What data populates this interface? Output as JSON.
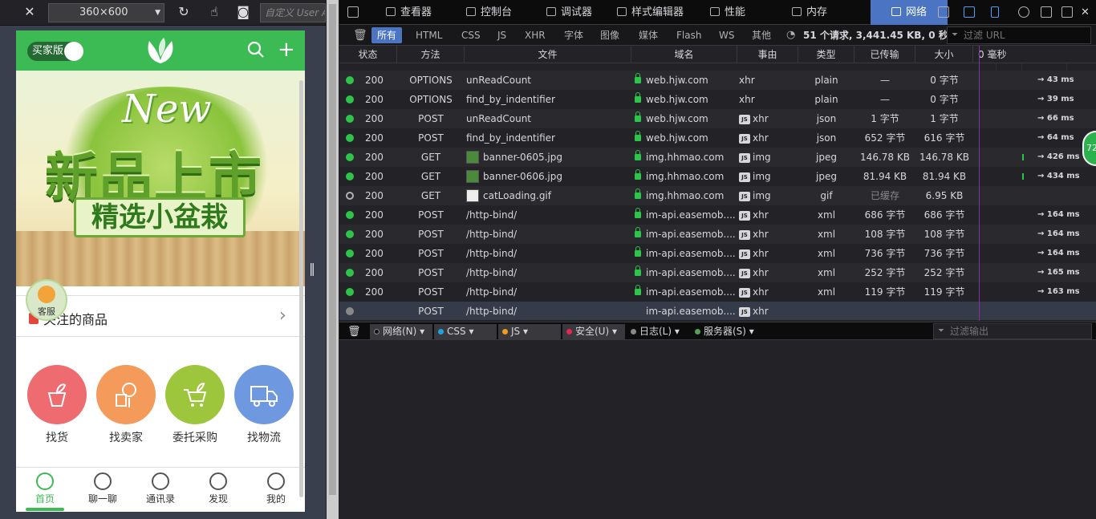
{
  "rdm": {
    "size_label": "360×600",
    "ua_placeholder": "自定义 User Agent"
  },
  "app": {
    "mode_label": "买家版",
    "banner": {
      "headline_en": "New",
      "headline": "新品上市",
      "subline": "精选小盆栽"
    },
    "kefu_label": "客服",
    "fav_label": "关注的商品",
    "categories": [
      {
        "label": "找货",
        "color": "#ee6b6f"
      },
      {
        "label": "找卖家",
        "color": "#f49a5a"
      },
      {
        "label": "委托采购",
        "color": "#9dc63d"
      },
      {
        "label": "找物流",
        "color": "#6e99e0"
      }
    ],
    "tabs": [
      "首页",
      "聊一聊",
      "通讯录",
      "发现",
      "我的"
    ]
  },
  "devtools": {
    "tabs": [
      "查看器",
      "控制台",
      "调试器",
      "样式编辑器",
      "性能",
      "内存",
      "网络"
    ],
    "filters": [
      "所有",
      "HTML",
      "CSS",
      "JS",
      "XHR",
      "字体",
      "图像",
      "媒体",
      "Flash",
      "WS",
      "其他"
    ],
    "summary": "51 个请求, 3,441.45 KB, 0 秒",
    "filter_placeholder": "过滤 URL",
    "columns": [
      "状态",
      "方法",
      "文件",
      "域名",
      "事由",
      "类型",
      "已传输",
      "大小",
      "0 毫秒"
    ],
    "requests": [
      {
        "status": "200",
        "method": "OPTIONS",
        "file": "unReadCount",
        "domain": "web.hjw.com",
        "cause": "xhr",
        "cause_js": false,
        "type": "plain",
        "transferred": "—",
        "size": "0 字节",
        "time": "→ 43 ms"
      },
      {
        "status": "200",
        "method": "OPTIONS",
        "file": "find_by_indentifier",
        "domain": "web.hjw.com",
        "cause": "xhr",
        "cause_js": false,
        "type": "plain",
        "transferred": "—",
        "size": "0 字节",
        "time": "→ 39 ms"
      },
      {
        "status": "200",
        "method": "POST",
        "file": "unReadCount",
        "domain": "web.hjw.com",
        "cause": "xhr",
        "cause_js": true,
        "type": "json",
        "transferred": "1 字节",
        "size": "1 字节",
        "time": "→ 66 ms"
      },
      {
        "status": "200",
        "method": "POST",
        "file": "find_by_indentifier",
        "domain": "web.hjw.com",
        "cause": "xhr",
        "cause_js": true,
        "type": "json",
        "transferred": "652 字节",
        "size": "616 字节",
        "time": "→ 64 ms"
      },
      {
        "status": "200",
        "method": "GET",
        "file": "banner-0605.jpg",
        "domain": "img.hhmao.com",
        "cause": "img",
        "cause_js": true,
        "type": "jpeg",
        "transferred": "146.78 KB",
        "size": "146.78 KB",
        "time": "→ 426 ms"
      },
      {
        "status": "200",
        "method": "GET",
        "file": "banner-0606.jpg",
        "domain": "img.hhmao.com",
        "cause": "img",
        "cause_js": true,
        "type": "jpeg",
        "transferred": "81.94 KB",
        "size": "81.94 KB",
        "time": "→ 434 ms"
      },
      {
        "status": "200",
        "method": "GET",
        "file": "catLoading.gif",
        "domain": "img.hhmao.com",
        "cause": "img",
        "cause_js": true,
        "type": "gif",
        "transferred": "已缓存",
        "size": "6.95 KB",
        "time": ""
      },
      {
        "status": "200",
        "method": "POST",
        "file": "/http-bind/",
        "domain": "im-api.easemob....",
        "cause": "xhr",
        "cause_js": true,
        "type": "xml",
        "transferred": "686 字节",
        "size": "686 字节",
        "time": "→ 164 ms"
      },
      {
        "status": "200",
        "method": "POST",
        "file": "/http-bind/",
        "domain": "im-api.easemob....",
        "cause": "xhr",
        "cause_js": true,
        "type": "xml",
        "transferred": "108 字节",
        "size": "108 字节",
        "time": "→ 164 ms"
      },
      {
        "status": "200",
        "method": "POST",
        "file": "/http-bind/",
        "domain": "im-api.easemob....",
        "cause": "xhr",
        "cause_js": true,
        "type": "xml",
        "transferred": "736 字节",
        "size": "736 字节",
        "time": "→ 164 ms"
      },
      {
        "status": "200",
        "method": "POST",
        "file": "/http-bind/",
        "domain": "im-api.easemob....",
        "cause": "xhr",
        "cause_js": true,
        "type": "xml",
        "transferred": "252 字节",
        "size": "252 字节",
        "time": "→ 165 ms"
      },
      {
        "status": "200",
        "method": "POST",
        "file": "/http-bind/",
        "domain": "im-api.easemob....",
        "cause": "xhr",
        "cause_js": true,
        "type": "xml",
        "transferred": "119 字节",
        "size": "119 字节",
        "time": "→ 163 ms"
      },
      {
        "status": "",
        "method": "POST",
        "file": "/http-bind/",
        "domain": "im-api.easemob....",
        "cause": "xhr",
        "cause_js": true,
        "type": "",
        "transferred": "",
        "size": "",
        "time": ""
      }
    ],
    "console_filters": [
      "网络(N)",
      "CSS",
      "JS",
      "安全(U)",
      "日志(L)",
      "服务器(S)"
    ],
    "console_placeholder": "过滤输出",
    "badge": "72"
  }
}
